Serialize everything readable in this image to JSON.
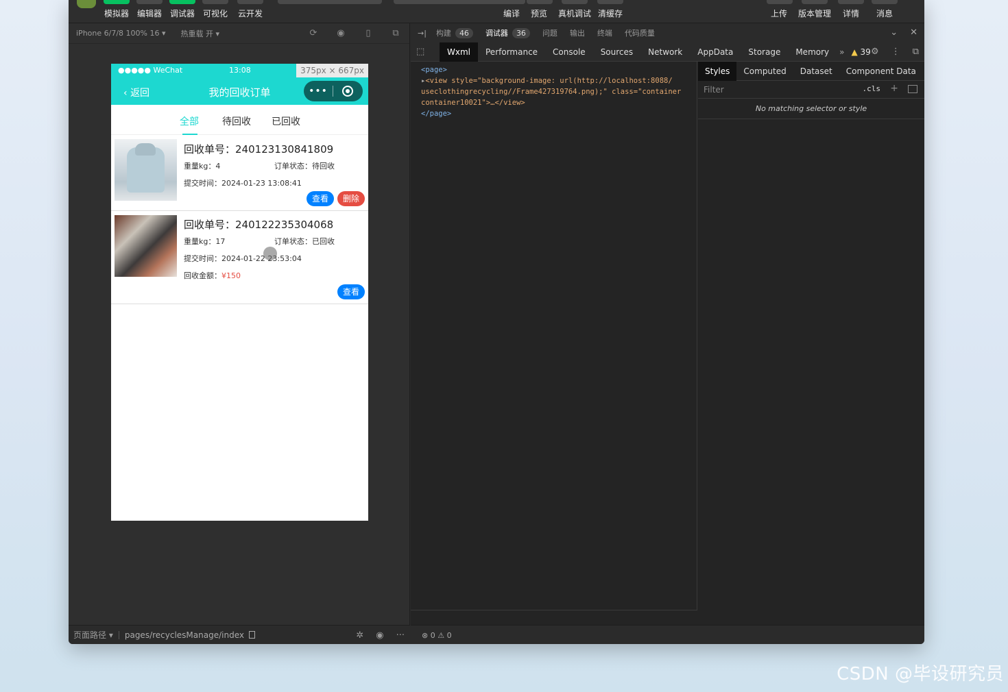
{
  "toolbar": {
    "left": [
      "模拟器",
      "编辑器",
      "调试器",
      "可视化",
      "云开发"
    ],
    "center": [
      "编译",
      "预览",
      "真机调试",
      "清缓存"
    ],
    "right": [
      "上传",
      "版本管理",
      "详情",
      "消息"
    ]
  },
  "simulator": {
    "device": "iPhone 6/7/8 100% 16 ▾",
    "hot_reload": "热重载 开 ▾",
    "size_tag": "375px × 667px",
    "status_carrier": "●●●●● WeChat",
    "status_time": "13:08",
    "back_label": "返回",
    "page_title": "我的回收订单",
    "capsule_dots": "•••",
    "tabs": [
      "全部",
      "待回收",
      "已回收"
    ],
    "orders": [
      {
        "no_label": "回收单号：",
        "no": "240123130841809",
        "weight": "重量kg：4",
        "status": "订单状态：待回收",
        "time": "提交时间：2024-01-23 13:08:41",
        "btn_view": "查看",
        "btn_delete": "删除"
      },
      {
        "no_label": "回收单号：",
        "no": "240122235304068",
        "weight": "重量kg：17",
        "status": "订单状态：已回收",
        "time": "提交时间：2024-01-22 23:53:04",
        "amount_label": "回收金额：",
        "amount": "¥150",
        "btn_view": "查看"
      }
    ],
    "footer_path_label": "页面路径 ▾",
    "footer_path": "pages/recyclesManage/index"
  },
  "devtools": {
    "top_tabs": [
      {
        "label": "构建",
        "badge": "46"
      },
      {
        "label": "调试器",
        "badge": "36"
      },
      {
        "label": "问题",
        "badge": ""
      },
      {
        "label": "输出",
        "badge": ""
      },
      {
        "label": "终端",
        "badge": ""
      },
      {
        "label": "代码质量",
        "badge": ""
      }
    ],
    "tabs": [
      "Wxml",
      "Performance",
      "Console",
      "Sources",
      "Network",
      "AppData",
      "Storage",
      "Memory"
    ],
    "warnings": "39",
    "wxml_lines": [
      "<page>",
      "<view style=\"background-image: url(http://localhost:8088/",
      "useclothingrecycling//Frame427319764.png);\" class=\"container",
      "container10021\">…</view>",
      "</page>"
    ],
    "style_tabs": [
      "Styles",
      "Computed",
      "Dataset",
      "Component Data"
    ],
    "filter_placeholder": "Filter",
    "cls": ".cls",
    "no_match": "No matching selector or style",
    "footer_status": "⊗ 0 ⚠ 0"
  },
  "watermark": "CSDN @毕设研究员"
}
